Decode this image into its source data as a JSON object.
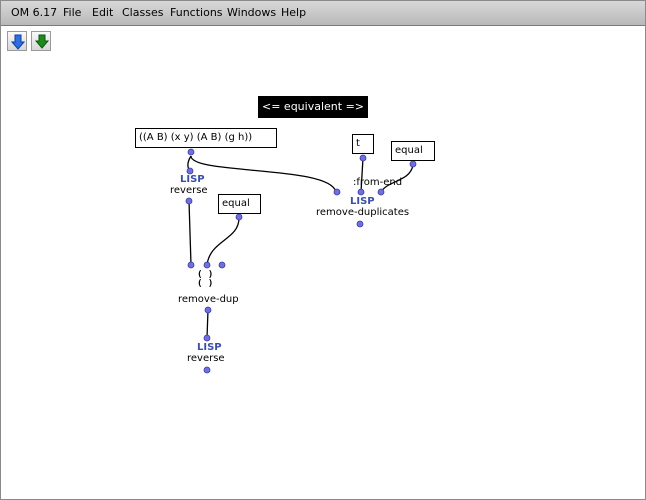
{
  "menubar": {
    "app_title": "OM 6.17",
    "items": [
      "File",
      "Edit",
      "Classes",
      "Functions",
      "Windows",
      "Help"
    ]
  },
  "toolbar": {
    "buttons": [
      {
        "name": "move-down-icon",
        "color": "#2f6fe0"
      },
      {
        "name": "go-down-icon",
        "color": "#1e8a1e"
      }
    ]
  },
  "patch": {
    "comment": "<= equivalent =>",
    "list_input": "((A B) (x y) (A B) (g h))",
    "equal_input_1": "equal",
    "equal_input_2": "equal",
    "t_input": "t",
    "keyword_label": ":from-end",
    "lisp_tag": "LISP",
    "reverse_label_1": "reverse",
    "reverse_label_2": "reverse",
    "remove_duplicates_label": "remove-duplicates",
    "remove_dup_label": "remove-dup",
    "dup_icon_top": "(   )",
    "dup_icon_bottom": "(   )"
  },
  "colors": {
    "inlet": "#6f6fe0",
    "lisp_text": "#3b4fa8",
    "connection": "#000000",
    "comment_bg": "#000000"
  }
}
